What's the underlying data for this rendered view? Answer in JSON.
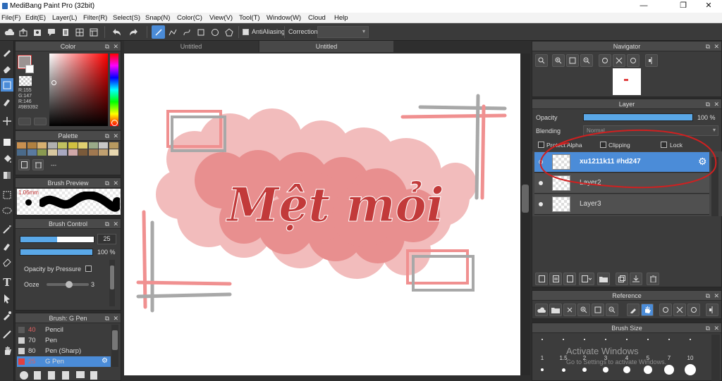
{
  "app": {
    "title": "MediBang Paint Pro (32bit)",
    "minimize": "—",
    "maximize": "❐",
    "close": "✕"
  },
  "menu": [
    "File(F)",
    "Edit(E)",
    "Layer(L)",
    "Filter(R)",
    "Select(S)",
    "Snap(N)",
    "Color(C)",
    "View(V)",
    "Tool(T)",
    "Window(W)",
    "Cloud",
    "Help"
  ],
  "toolbar": {
    "antialiasing": "AntiAliasing",
    "correction": "Correction"
  },
  "color_panel": {
    "title": "Color",
    "main_color": "#9B9392",
    "readout": {
      "r": "R:155",
      "g": "G:147",
      "b": "R:146",
      "hex": "#9B9392"
    }
  },
  "palette_panel": {
    "title": "Palette",
    "swatches": [
      "#c89050",
      "#b08040",
      "#d8b070",
      "#b0b0b0",
      "#c0c060",
      "#d0c040",
      "#e0d070",
      "#9aaa88",
      "#c8c8c8",
      "#b89a60",
      "#4a6a8a",
      "#5a7aa0",
      "#8a9a50",
      "#d8c8a0",
      "#a8a8c0",
      "#d0a8a8",
      "#7a5a3a",
      "#a07850",
      "#c0a070",
      "#e8d8b0"
    ],
    "separator": "---"
  },
  "brush_preview": {
    "title": "Brush Preview",
    "size_label": "1.06mm"
  },
  "brush_control": {
    "title": "Brush Control",
    "size_value": "25",
    "opacity_value": "100 %",
    "opacity_by_pressure": "Opacity by Pressure",
    "ooze_label": "Ooze",
    "ooze_value": "3"
  },
  "brush_list": {
    "title": "Brush: G Pen",
    "items": [
      {
        "num": "40",
        "name": "Pencil",
        "color": "#5a5a5a"
      },
      {
        "num": "70",
        "name": "Pen",
        "color": "#d0d0d0"
      },
      {
        "num": "80",
        "name": "Pen (Sharp)",
        "color": "#d0d0d0"
      },
      {
        "num": "25",
        "name": "G Pen",
        "color": "#e04040"
      }
    ]
  },
  "tabs": [
    "Untitled",
    "Untitled"
  ],
  "artwork": {
    "text": "Mệt mỏi"
  },
  "navigator": {
    "title": "Navigator"
  },
  "layer_panel": {
    "title": "Layer",
    "opacity_label": "Opacity",
    "opacity_value": "100 %",
    "blending_label": "Blending",
    "blending_value": "Normal",
    "protect_alpha": "Protect Alpha",
    "clipping": "Clipping",
    "lock": "Lock",
    "layers": [
      "xu1211k11 #hd247",
      "Layer2",
      "Layer3"
    ]
  },
  "reference": {
    "title": "Reference"
  },
  "brush_size": {
    "title": "Brush Size",
    "sizes": [
      "1",
      "1.5",
      "2",
      "3",
      "4",
      "5",
      "7",
      "10"
    ],
    "watermark_line1": "Activate Windows",
    "watermark_line2": "Go to Settings to activate Windows."
  }
}
